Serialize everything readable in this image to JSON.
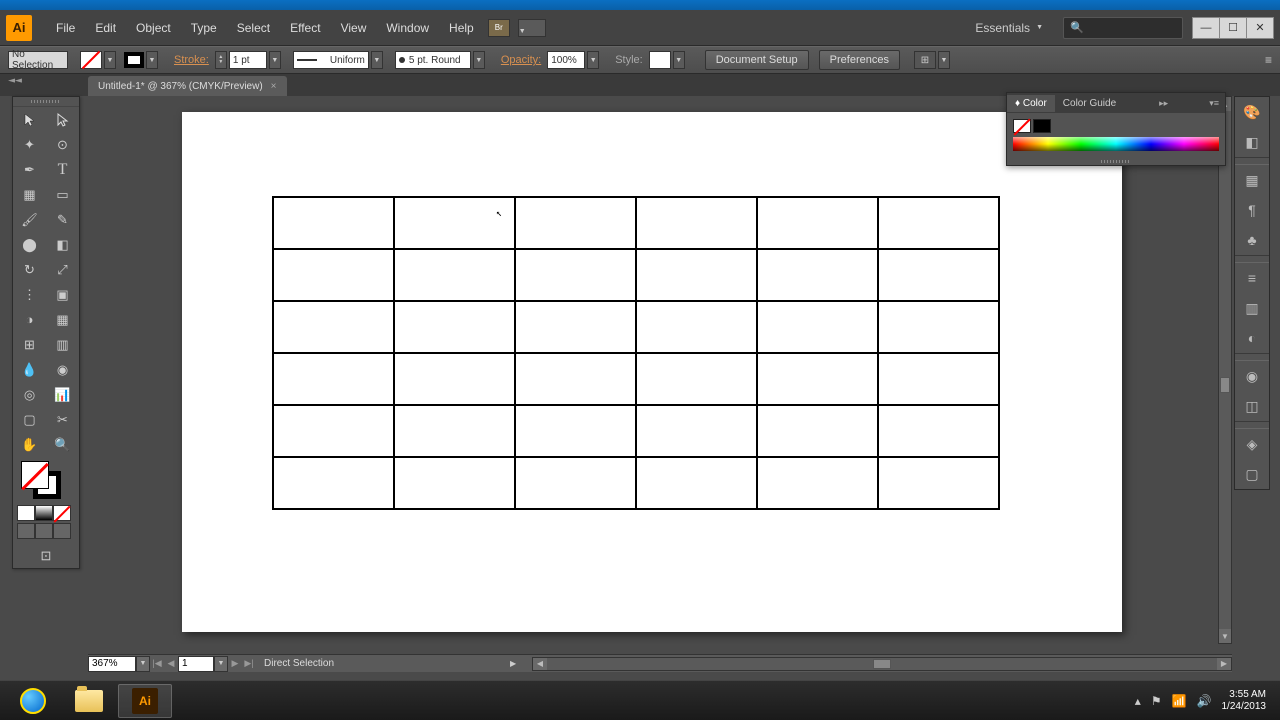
{
  "app": {
    "logo": "Ai"
  },
  "menu": [
    "File",
    "Edit",
    "Object",
    "Type",
    "Select",
    "Effect",
    "View",
    "Window",
    "Help"
  ],
  "workspace": "Essentials",
  "search_placeholder": "",
  "control": {
    "selection": "No Selection",
    "stroke_label": "Stroke:",
    "stroke_weight": "1 pt",
    "profile": "Uniform",
    "brush": "5 pt. Round",
    "opacity_label": "Opacity:",
    "opacity": "100%",
    "style_label": "Style:",
    "doc_setup": "Document Setup",
    "preferences": "Preferences"
  },
  "document": {
    "tab": "Untitled-1* @ 367% (CMYK/Preview)"
  },
  "color_panel": {
    "tab1": "Color",
    "tab2": "Color Guide"
  },
  "status": {
    "zoom": "367%",
    "page": "1",
    "tool": "Direct Selection"
  },
  "clock": {
    "time": "3:55 AM",
    "date": "1/24/2013"
  },
  "grid": {
    "rows": 6,
    "cols": 6
  }
}
